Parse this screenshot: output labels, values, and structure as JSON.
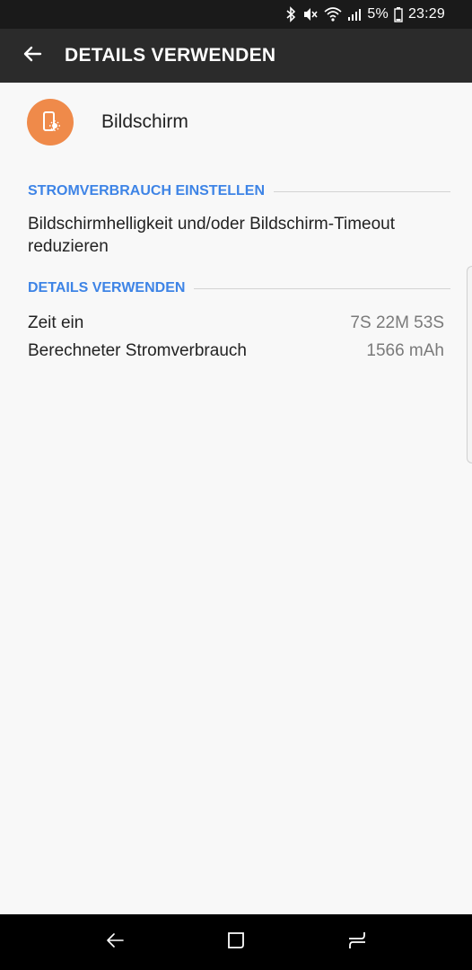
{
  "status_bar": {
    "icons": [
      "bluetooth-icon",
      "mute-icon",
      "wifi-icon",
      "signal-icon"
    ],
    "battery_percent": "5%",
    "battery_icon": "battery-low-icon",
    "time": "23:29"
  },
  "app_bar": {
    "back_icon": "arrow-left-icon",
    "title": "DETAILS VERWENDEN"
  },
  "app": {
    "icon": "screen-brightness-icon",
    "icon_color": "#ef8a4a",
    "name": "Bildschirm"
  },
  "section_power": {
    "header": "STROMVERBRAUCH EINSTELLEN",
    "tip": "Bildschirmhelligkeit und/oder Bildschirm-Timeout reduzieren"
  },
  "section_details": {
    "header": "DETAILS VERWENDEN",
    "rows": [
      {
        "label": "Zeit ein",
        "value": "7S 22M 53S"
      },
      {
        "label": "Berechneter Stromverbrauch",
        "value": "1566 mAh"
      }
    ]
  },
  "nav_bar": {
    "back_icon": "back-icon",
    "home_icon": "home-icon",
    "recents_icon": "recents-icon"
  },
  "colors": {
    "accent": "#3e84e6",
    "app_bar": "#2b2b2b",
    "status_bar": "#1a1a1a"
  }
}
